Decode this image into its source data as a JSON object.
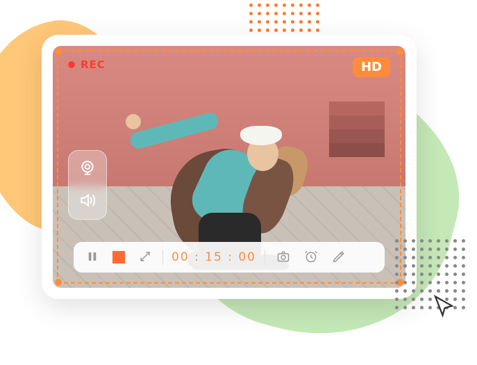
{
  "recording": {
    "indicator_label": "REC",
    "quality_badge": "HD",
    "timer": "00 : 15 : 00"
  },
  "side_panel": {
    "webcam_icon": "webcam",
    "audio_icon": "speaker"
  },
  "toolbar": {
    "pause_icon": "pause",
    "stop_icon": "stop",
    "resize_icon": "expand-arrows",
    "screenshot_icon": "camera",
    "schedule_icon": "alarm-clock",
    "annotate_icon": "pencil"
  },
  "colors": {
    "accent": "#ff8c3a",
    "record": "#ff3b30"
  }
}
